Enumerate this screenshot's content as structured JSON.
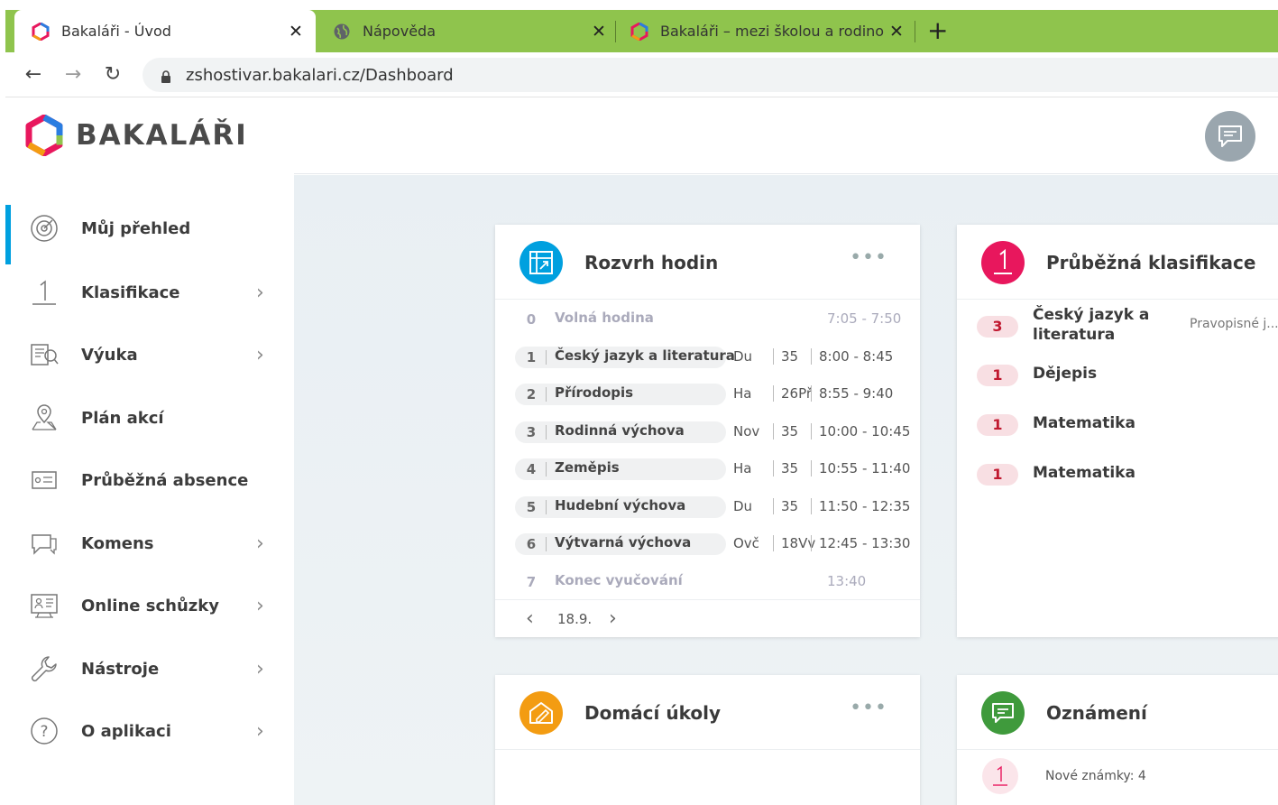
{
  "browser": {
    "tabs": [
      {
        "title": "Bakaláři - Úvod",
        "active": true
      },
      {
        "title": "Nápověda",
        "active": false
      },
      {
        "title": "Bakaláři – mezi školou a rodinou",
        "active": false
      }
    ],
    "url": "zshostivar.bakalari.cz/Dashboard"
  },
  "sidebar": {
    "logo_text": "BAKALÁŘI",
    "items": [
      {
        "label": "Můj přehled",
        "icon": "dashboard-icon",
        "chevron": false,
        "active": true
      },
      {
        "label": "Klasifikace",
        "icon": "grade-icon",
        "chevron": true
      },
      {
        "label": "Výuka",
        "icon": "teaching-icon",
        "chevron": true
      },
      {
        "label": "Plán akcí",
        "icon": "map-pin-icon",
        "chevron": false
      },
      {
        "label": "Průběžná absence",
        "icon": "absence-icon",
        "chevron": false
      },
      {
        "label": "Komens",
        "icon": "messages-icon",
        "chevron": true
      },
      {
        "label": "Online schůzky",
        "icon": "meeting-icon",
        "chevron": true
      },
      {
        "label": "Nástroje",
        "icon": "wrench-icon",
        "chevron": true
      },
      {
        "label": "O aplikaci",
        "icon": "help-icon",
        "chevron": true
      }
    ]
  },
  "schedule": {
    "title": "Rozvrh hodin",
    "rows": [
      {
        "num": "0",
        "subject": "Volná hodina",
        "room": "",
        "class": "",
        "time": "7:05 - 7:50",
        "muted": true
      },
      {
        "num": "1",
        "subject": "Český jazyk a literatura",
        "room": "Du",
        "class": "35",
        "time": "8:00 - 8:45"
      },
      {
        "num": "2",
        "subject": "Přírodopis",
        "room": "Ha",
        "class": "26Př",
        "time": "8:55 - 9:40"
      },
      {
        "num": "3",
        "subject": "Rodinná výchova",
        "room": "Nov",
        "class": "35",
        "time": "10:00 - 10:45"
      },
      {
        "num": "4",
        "subject": "Zeměpis",
        "room": "Ha",
        "class": "35",
        "time": "10:55 - 11:40"
      },
      {
        "num": "5",
        "subject": "Hudební výchova",
        "room": "Du",
        "class": "35",
        "time": "11:50 - 12:35"
      },
      {
        "num": "6",
        "subject": "Výtvarná výchova",
        "room": "Ovč",
        "class": "18Vv",
        "time": "12:45 - 13:30"
      },
      {
        "num": "7",
        "subject": "Konec vyučování",
        "room": "",
        "class": "",
        "time": "13:40",
        "muted": true
      }
    ],
    "date": "18.9."
  },
  "grades": {
    "title": "Průběžná klasifikace",
    "rows": [
      {
        "grade": "3",
        "subject": "Český jazyk a literatura",
        "note": "Pravopisné j..."
      },
      {
        "grade": "1",
        "subject": "Dějepis",
        "note": ""
      },
      {
        "grade": "1",
        "subject": "Matematika",
        "note": ""
      },
      {
        "grade": "1",
        "subject": "Matematika",
        "note": ""
      }
    ]
  },
  "homework": {
    "title": "Domácí úkoly"
  },
  "notices": {
    "title": "Oznámení",
    "items": [
      {
        "text": "Nové známky: 4"
      }
    ]
  },
  "colors": {
    "tabbar": "#8fc44d",
    "accent": "#00a0df",
    "grade_badge_text": "#c0182f",
    "grades_icon": "#e8175d",
    "homework_icon": "#f39c12",
    "notices_icon": "#3f9a3c"
  }
}
